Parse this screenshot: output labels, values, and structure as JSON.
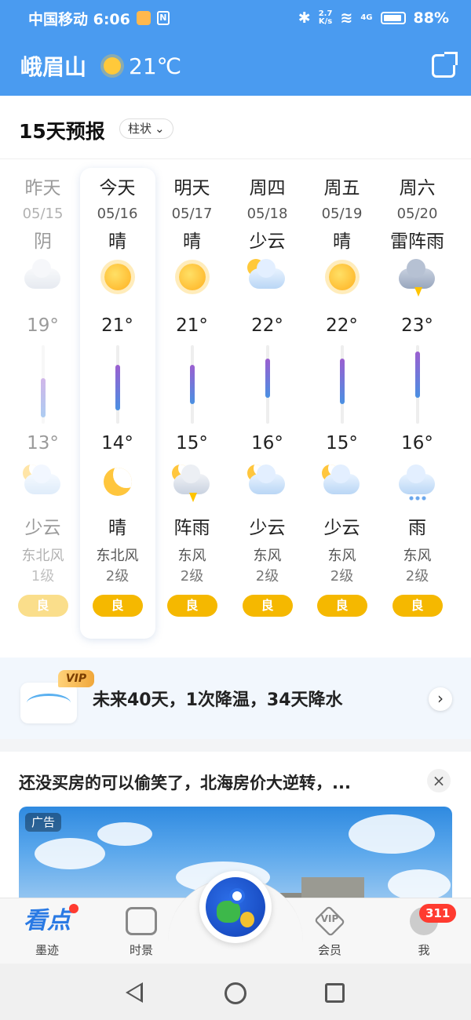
{
  "status_bar": {
    "carrier_time": "中国移动 6:06",
    "speed_value": "2.7",
    "speed_unit": "K/s",
    "network": "4G",
    "battery": "88%"
  },
  "header": {
    "city": "峨眉山",
    "current_temp": "21℃",
    "weather_icon": "sun-icon",
    "share_icon": "share-icon"
  },
  "forecast": {
    "title": "15天预报",
    "mode": "柱状",
    "days": [
      {
        "name": "昨天",
        "date": "05/15",
        "day_weather": "阴",
        "day_icon": "overcast",
        "high": "19°",
        "high_value": 19,
        "low": "13°",
        "low_value": 13,
        "night_icon": "partly-cloudy-night",
        "night_weather": "少云",
        "wind_dir": "东北风",
        "wind_level": "1级",
        "aqi": "良"
      },
      {
        "name": "今天",
        "date": "05/16",
        "day_weather": "晴",
        "day_icon": "sunny",
        "high": "21°",
        "high_value": 21,
        "low": "14°",
        "low_value": 14,
        "night_icon": "clear-night",
        "night_weather": "晴",
        "wind_dir": "东北风",
        "wind_level": "2级",
        "aqi": "良"
      },
      {
        "name": "明天",
        "date": "05/17",
        "day_weather": "晴",
        "day_icon": "sunny",
        "high": "21°",
        "high_value": 21,
        "low": "15°",
        "low_value": 15,
        "night_icon": "shower-night",
        "night_weather": "阵雨",
        "wind_dir": "东风",
        "wind_level": "2级",
        "aqi": "良"
      },
      {
        "name": "周四",
        "date": "05/18",
        "day_weather": "少云",
        "day_icon": "partly-cloudy",
        "high": "22°",
        "high_value": 22,
        "low": "16°",
        "low_value": 16,
        "night_icon": "partly-cloudy-night",
        "night_weather": "少云",
        "wind_dir": "东风",
        "wind_level": "2级",
        "aqi": "良"
      },
      {
        "name": "周五",
        "date": "05/19",
        "day_weather": "晴",
        "day_icon": "sunny",
        "high": "22°",
        "high_value": 22,
        "low": "15°",
        "low_value": 15,
        "night_icon": "partly-cloudy-night",
        "night_weather": "少云",
        "wind_dir": "东风",
        "wind_level": "2级",
        "aqi": "良"
      },
      {
        "name": "周六",
        "date": "05/20",
        "day_weather": "雷阵雨",
        "day_icon": "thunderstorm",
        "high": "23°",
        "high_value": 23,
        "low": "16°",
        "low_value": 16,
        "night_icon": "rain",
        "night_weather": "雨",
        "wind_dir": "东风",
        "wind_level": "2级",
        "aqi": "良"
      }
    ],
    "aqi_color": "#f5b800"
  },
  "vip_banner": {
    "badge": "VIP",
    "text": "未来40天，1次降温，34天降水",
    "arrow": "›"
  },
  "news": {
    "title": "还没买房的可以偷笑了，北海房价大逆转，...",
    "close": "×",
    "ad_label": "广告"
  },
  "bottom_nav": {
    "items": [
      {
        "id": "kandian",
        "icon_text": "看点",
        "label": "墨迹",
        "icon": "kandian-icon"
      },
      {
        "id": "shijing",
        "label": "时景",
        "icon": "picture-icon"
      },
      {
        "id": "huiyuan",
        "label": "会员",
        "icon": "vip-icon",
        "icon_text": "VIP"
      },
      {
        "id": "me",
        "label": "我",
        "icon": "profile-icon",
        "badge": "311"
      }
    ],
    "center_icon": "globe-icon"
  },
  "colors": {
    "header_blue": "#4a9bf0",
    "accent_blue": "#2a7ae4",
    "bar_gradient_top": "#9b5fd0",
    "bar_gradient_bottom": "#4a90e2"
  }
}
